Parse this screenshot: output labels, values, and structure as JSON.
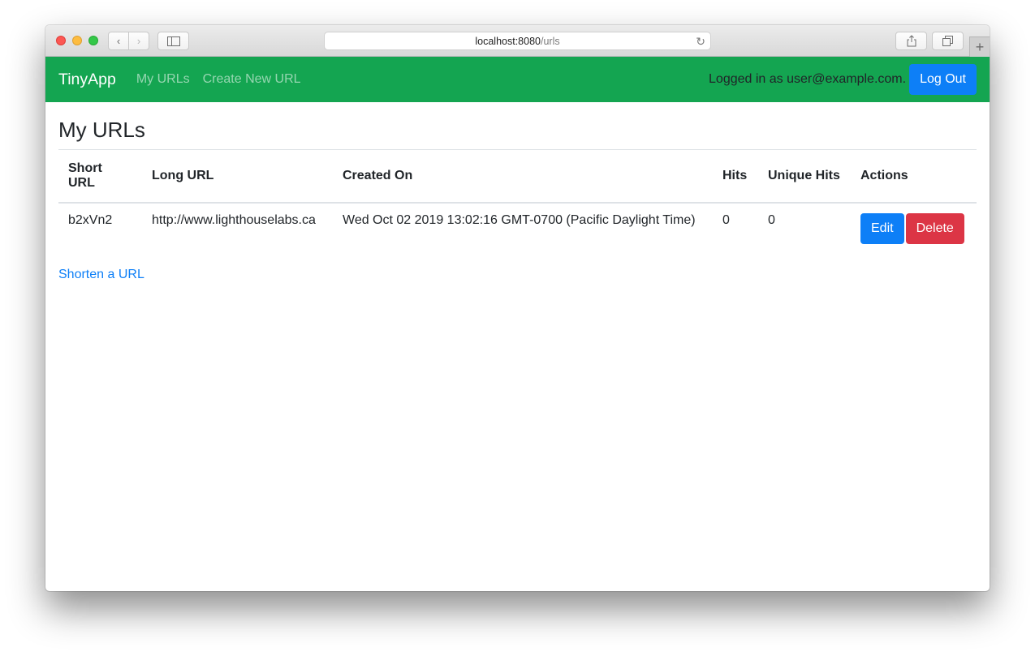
{
  "browser": {
    "url_host": "localhost:8080",
    "url_path": "/urls",
    "icons": {
      "back": "chevron-left-icon",
      "forward": "chevron-right-icon",
      "sidebar": "sidebar-icon",
      "reload": "reload-icon",
      "share": "share-icon",
      "tabs": "tabs-icon",
      "new_tab": "plus-icon"
    }
  },
  "navbar": {
    "brand": "TinyApp",
    "links": [
      "My URLs",
      "Create New URL"
    ],
    "logged_in_text": "Logged in as user@example.com.",
    "logout_label": "Log Out"
  },
  "main": {
    "title": "My URLs",
    "table": {
      "headers": [
        "Short URL",
        "Long URL",
        "Created On",
        "Hits",
        "Unique Hits",
        "Actions"
      ],
      "rows": [
        {
          "short_url": "b2xVn2",
          "long_url": "http://www.lighthouselabs.ca",
          "created_on": "Wed Oct 02 2019 13:02:16 GMT-0700 (Pacific Daylight Time)",
          "hits": "0",
          "unique_hits": "0",
          "edit_label": "Edit",
          "delete_label": "Delete"
        }
      ]
    },
    "shorten_link": "Shorten a URL"
  },
  "colors": {
    "navbar": "#14a551",
    "primary": "#0d7ff7",
    "danger": "#dc3545"
  }
}
